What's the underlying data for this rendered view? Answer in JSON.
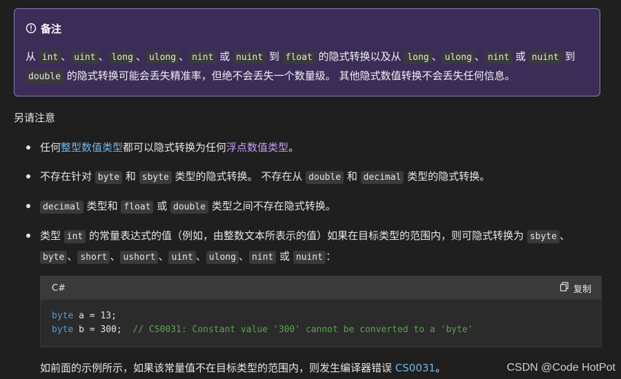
{
  "note": {
    "title": "备注",
    "text_parts": {
      "p1": "从 ",
      "c_int": "int",
      "s1": "、",
      "c_uint": "uint",
      "s2": "、",
      "c_long": "long",
      "s3": "、",
      "c_ulong": "ulong",
      "s4": "、",
      "c_nint": "nint",
      "s5": " 或 ",
      "c_nuint": "nuint",
      "s6": " 到 ",
      "c_float": "float",
      "s7": " 的隐式转换以及从 ",
      "c_long2": "long",
      "s8": "、",
      "c_ulong2": "ulong",
      "s9": "、",
      "c_nint2": "nint",
      "s10": " 或 ",
      "c_nuint2": "nuint",
      "s11": " 到",
      "c_double": "double",
      "s12": " 的隐式转换可能会丢失精准率，但绝不会丢失一个数量级。 其他隐式数值转换不会丢失任何信息。"
    }
  },
  "aside": "另请注意",
  "bullets": {
    "b1": {
      "pre": "任何",
      "link1": "整型数值类型",
      "mid": "都可以隐式转换为任何",
      "link2": "浮点数值类型",
      "post": "。"
    },
    "b2": {
      "t1": "不存在针对 ",
      "c1": "byte",
      "t2": " 和 ",
      "c2": "sbyte",
      "t3": " 类型的隐式转换。 不存在从 ",
      "c3": "double",
      "t4": " 和 ",
      "c4": "decimal",
      "t5": " 类型的隐式转换。"
    },
    "b3": {
      "c1": "decimal",
      "t1": " 类型和 ",
      "c2": "float",
      "t2": " 或 ",
      "c3": "double",
      "t3": " 类型之间不存在隐式转换。"
    },
    "b4": {
      "t1": "类型 ",
      "c1": "int",
      "t2": " 的常量表达式的值（例如，由整数文本所表示的值）如果在目标类型的范围内，则可隐式转换为 ",
      "c2": "sbyte",
      "t3": "、",
      "c3": "byte",
      "t4": "、",
      "c4": "short",
      "t5": "、",
      "c5": "ushort",
      "t6": "、",
      "c6": "uint",
      "t7": "、",
      "c7": "ulong",
      "t8": "、",
      "c8": "nint",
      "t9": " 或 ",
      "c9": "nuint",
      "t10": "："
    }
  },
  "codeblock": {
    "language": "C#",
    "copy_label": "复制",
    "line1": {
      "kw": "byte",
      "rest": " a = 13;"
    },
    "line2": {
      "kw": "byte",
      "rest": " b = 300;  ",
      "comment": "// CS0031: Constant value '300' cannot be converted to a 'byte'"
    }
  },
  "tail": {
    "text": "如前面的示例所示，如果该常量值不在目标类型的范围内，则发生编译器错误 ",
    "link": "CS0031",
    "post": "。"
  },
  "watermark": "CSDN @Code HotPot",
  "icons": {
    "note": "info-circle-icon",
    "copy": "copy-icon"
  },
  "colors": {
    "background": "#1f1f1f",
    "note_bg": "#3b2d57",
    "note_border": "#8d7ab3",
    "link_blue": "#75b6e7",
    "link_purple": "#c89cf5",
    "keyword": "#569cd6",
    "comment": "#57a64a"
  }
}
